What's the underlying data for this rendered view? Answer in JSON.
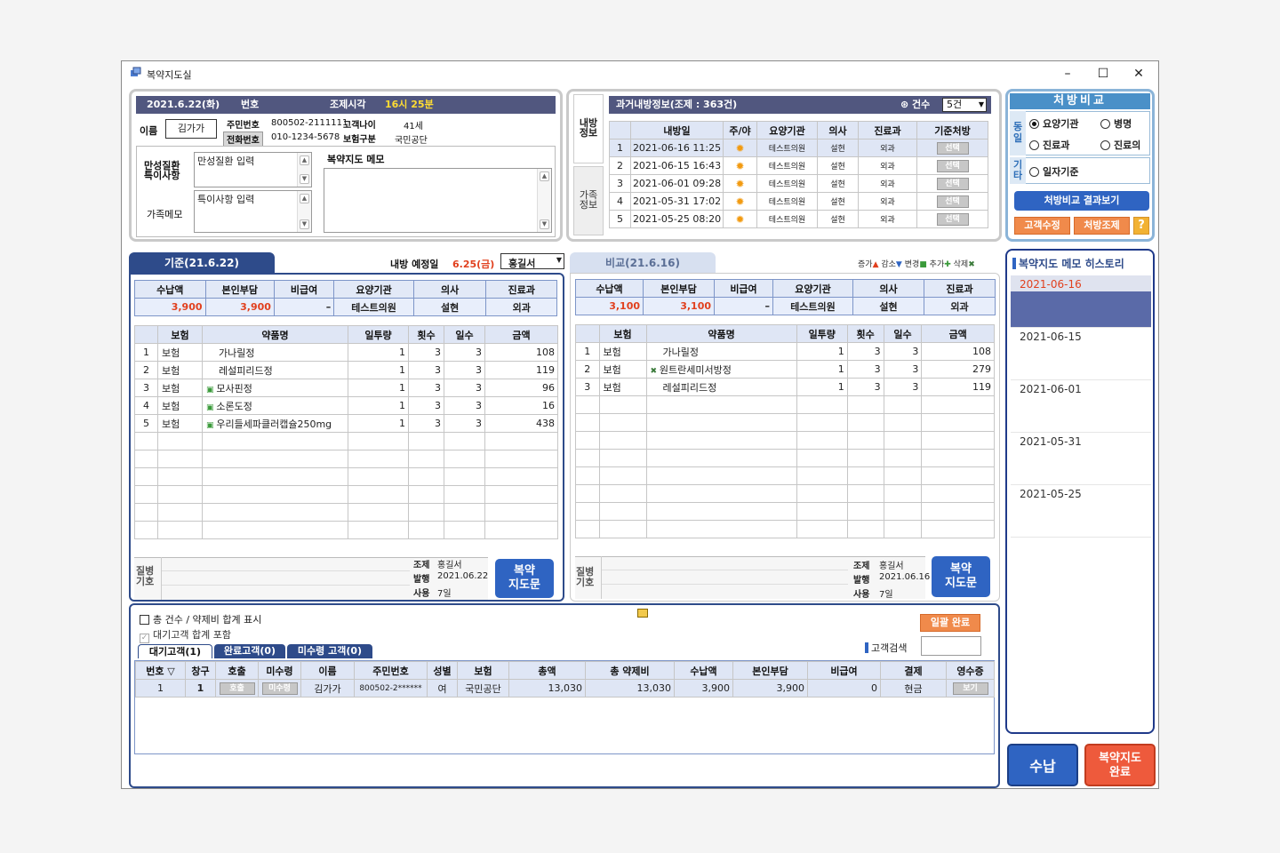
{
  "window": {
    "title": "복약지도실",
    "min": "–",
    "max": "☐",
    "close": "✕"
  },
  "patient": {
    "date": "2021.6.22(화)",
    "no_label": "번호",
    "time_label": "조제시각",
    "time_value": "16시 25분",
    "name_label": "이름",
    "name": "김가가",
    "rrn_label": "주민번호",
    "rrn": "800502-2111111",
    "age_label": "고객나이",
    "age": "41세",
    "phone_label": "전화번호",
    "phone": "010-1234-5678",
    "ins_label": "보험구분",
    "ins": "국민공단",
    "chronic_label": "만성질환\n특이사항",
    "chronic_placeholder": "만성질환 입력",
    "special_placeholder": "특이사항 입력",
    "family_label": "가족메모",
    "memo_label": "복약지도 메모"
  },
  "past": {
    "side_tab1": "내방\n정보",
    "side_tab2": "가족\n정보",
    "header": "과거내방정보(조제 : 363건)",
    "count_label": "건수",
    "count_value": "5건",
    "columns": [
      "내방일",
      "주/야",
      "요양기관",
      "의사",
      "진료과",
      "기준처방"
    ],
    "rows": [
      {
        "n": "1",
        "date": "2021-06-16 11:25",
        "inst": "테스트의원",
        "doc": "설현",
        "dept": "외과",
        "btn": "선택"
      },
      {
        "n": "2",
        "date": "2021-06-15 16:43",
        "inst": "테스트의원",
        "doc": "설현",
        "dept": "외과",
        "btn": "선택"
      },
      {
        "n": "3",
        "date": "2021-06-01 09:28",
        "inst": "테스트의원",
        "doc": "설현",
        "dept": "외과",
        "btn": "선택"
      },
      {
        "n": "4",
        "date": "2021-05-31 17:02",
        "inst": "테스트의원",
        "doc": "설현",
        "dept": "외과",
        "btn": "선택"
      },
      {
        "n": "5",
        "date": "2021-05-25 08:20",
        "inst": "테스트의원",
        "doc": "설현",
        "dept": "외과",
        "btn": "선택"
      }
    ]
  },
  "compare_opts": {
    "title": "처방비교",
    "same_label": "동\n일",
    "etc_label": "기\n타",
    "opt1": "요양기관",
    "opt2": "병명",
    "opt3": "진료과",
    "opt4": "진료의",
    "opt5": "일자기준",
    "result_btn": "처방비교 결과보기",
    "edit_btn": "고객수정",
    "rx_btn": "처방조제",
    "help_btn": "?"
  },
  "base": {
    "tab": "기준(21.6.22)",
    "visit_label": "내방 예정일",
    "visit_date": "6.25(금)",
    "pharmacist": "홍길서",
    "sum_cols": [
      "수납액",
      "본인부담",
      "비급여",
      "요양기관",
      "의사",
      "진료과"
    ],
    "sum_vals": [
      "3,900",
      "3,900",
      "–",
      "테스트의원",
      "설현",
      "외과"
    ],
    "drug_cols": [
      "보험",
      "약품명",
      "일투량",
      "횟수",
      "일수",
      "금액"
    ],
    "drugs": [
      {
        "n": "1",
        "ins": "보험",
        "name": "가나릴정",
        "dose": "1",
        "times": "3",
        "days": "3",
        "amt": "108",
        "icon": false
      },
      {
        "n": "2",
        "ins": "보험",
        "name": "레설피리드정",
        "dose": "1",
        "times": "3",
        "days": "3",
        "amt": "119",
        "icon": false
      },
      {
        "n": "3",
        "ins": "보험",
        "name": "모사핀정",
        "dose": "1",
        "times": "3",
        "days": "3",
        "amt": "96",
        "icon": true
      },
      {
        "n": "4",
        "ins": "보험",
        "name": "소론도정",
        "dose": "1",
        "times": "3",
        "days": "3",
        "amt": "16",
        "icon": true
      },
      {
        "n": "5",
        "ins": "보험",
        "name": "우리들세파클러캡슐250mg",
        "dose": "1",
        "times": "3",
        "days": "3",
        "amt": "438",
        "icon": true
      }
    ],
    "disease_label": "질병\n기호",
    "jo_label": "조제",
    "jo_val": "홍길서",
    "bal_label": "발행",
    "bal_val": "2021.06.22",
    "use_label": "사용",
    "use_val": "7일",
    "guide_btn": "복약\n지도문"
  },
  "cmp": {
    "tab": "비교(21.6.16)",
    "legend": "증가🡅 감소🡇 변경 추가 삭제✖",
    "legend_items": [
      "증가",
      "감소",
      "변경",
      "추가",
      "삭제"
    ],
    "sum_cols": [
      "수납액",
      "본인부담",
      "비급여",
      "요양기관",
      "의사",
      "진료과"
    ],
    "sum_vals": [
      "3,100",
      "3,100",
      "–",
      "테스트의원",
      "설현",
      "외과"
    ],
    "drug_cols": [
      "보험",
      "약품명",
      "일투량",
      "횟수",
      "일수",
      "금액"
    ],
    "drugs": [
      {
        "n": "1",
        "ins": "보험",
        "name": "가나릴정",
        "dose": "1",
        "times": "3",
        "days": "3",
        "amt": "108",
        "icon": false
      },
      {
        "n": "2",
        "ins": "보험",
        "name": "원트란세미서방정",
        "dose": "1",
        "times": "3",
        "days": "3",
        "amt": "279",
        "icon": true
      },
      {
        "n": "3",
        "ins": "보험",
        "name": "레설피리드정",
        "dose": "1",
        "times": "3",
        "days": "3",
        "amt": "119",
        "icon": false
      }
    ],
    "disease_label": "질병\n기호",
    "jo_label": "조제",
    "jo_val": "홍길서",
    "bal_label": "발행",
    "bal_val": "2021.06.16",
    "use_label": "사용",
    "use_val": "7일",
    "guide_btn": "복약\n지도문"
  },
  "history": {
    "title": "복약지도 메모 히스토리",
    "dates": [
      "2021-06-16",
      "2021-06-15",
      "2021-06-01",
      "2021-05-31",
      "2021-05-25"
    ],
    "active_color": "#e1401e"
  },
  "queue": {
    "chk1": "총 건수 / 약제비 합계 표시",
    "chk2": "대기고객 합계 포함",
    "tabs": [
      "대기고객(1)",
      "완료고객(0)",
      "미수령 고객(0)"
    ],
    "done_all": "일괄 완료",
    "search_label": "고객검색",
    "cols": [
      "번호",
      "창구",
      "호출",
      "미수령",
      "이름",
      "주민번호",
      "성별",
      "보험",
      "총액",
      "총 약제비",
      "수납액",
      "본인부담",
      "비급여",
      "결제",
      "영수증"
    ],
    "rows": [
      {
        "no": "1",
        "win": "1",
        "call": "호출",
        "unrec": "미수령",
        "name": "김가가",
        "rrn": "800502-2******",
        "sex": "여",
        "ins": "국민공단",
        "total": "13,030",
        "drug": "13,030",
        "paid": "3,900",
        "self": "3,900",
        "nonpay": "0",
        "pay": "현금",
        "rcpt": "보기"
      }
    ]
  },
  "actions": {
    "pay": "수납",
    "done": "복약지도\n완료"
  },
  "colors": {
    "navy": "#2e4b8a",
    "header": "#51577f",
    "orange": "#f08a4b",
    "red": "#e1401e",
    "blue_btn": "#2f64c2"
  }
}
